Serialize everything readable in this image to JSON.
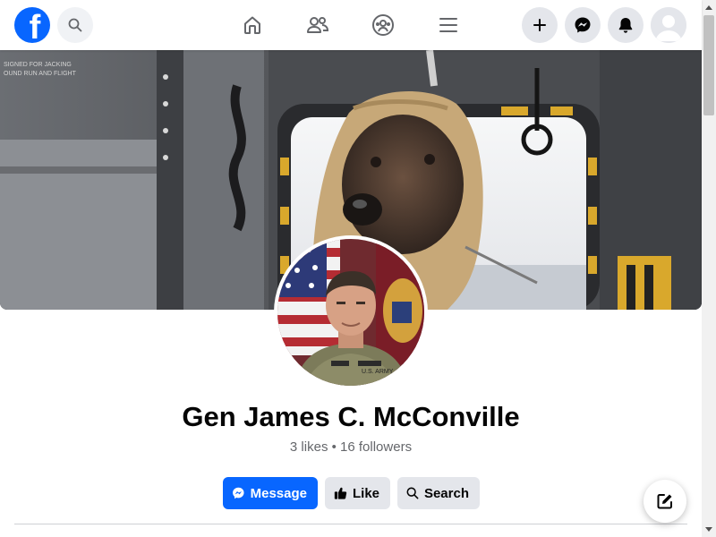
{
  "header": {
    "logo_icon": "facebook-logo-icon",
    "logo_letter": "f",
    "search_icon": "search-icon",
    "nav": [
      {
        "icon": "home-icon"
      },
      {
        "icon": "friends-icon"
      },
      {
        "icon": "groups-icon"
      },
      {
        "icon": "menu-icon"
      }
    ],
    "right_buttons": [
      {
        "icon": "plus-icon"
      },
      {
        "icon": "messenger-icon"
      },
      {
        "icon": "bell-icon"
      },
      {
        "icon": "account-avatar-icon"
      }
    ]
  },
  "profile": {
    "name": "Gen James C. McConville",
    "stats": "3 likes • 16 followers",
    "cover_image": "military working dog in helicopter cabin",
    "profile_image": "official portrait in front of flags"
  },
  "actions": {
    "message_label": "Message",
    "like_label": "Like",
    "search_label": "Search"
  },
  "colors": {
    "brand": "#0866ff",
    "secondary_button": "#e4e6eb",
    "text_primary": "#050505",
    "text_secondary": "#65676b"
  }
}
